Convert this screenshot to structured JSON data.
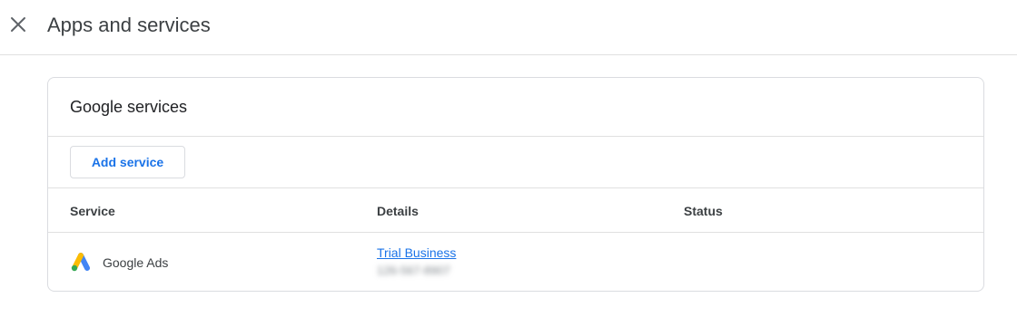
{
  "header": {
    "title": "Apps and services",
    "close_icon": "close-icon"
  },
  "card": {
    "title": "Google services",
    "add_button_label": "Add service",
    "columns": [
      "Service",
      "Details",
      "Status"
    ],
    "rows": [
      {
        "service": "Google Ads",
        "service_icon": "google-ads-icon",
        "details_link": "Trial Business",
        "details_id": "126-567-8907",
        "status": ""
      }
    ]
  },
  "colors": {
    "accent": "#1a73e8",
    "border": "#dadce0",
    "ads_blue": "#4285f4",
    "ads_yellow": "#fbbc04",
    "ads_green": "#34a853"
  }
}
